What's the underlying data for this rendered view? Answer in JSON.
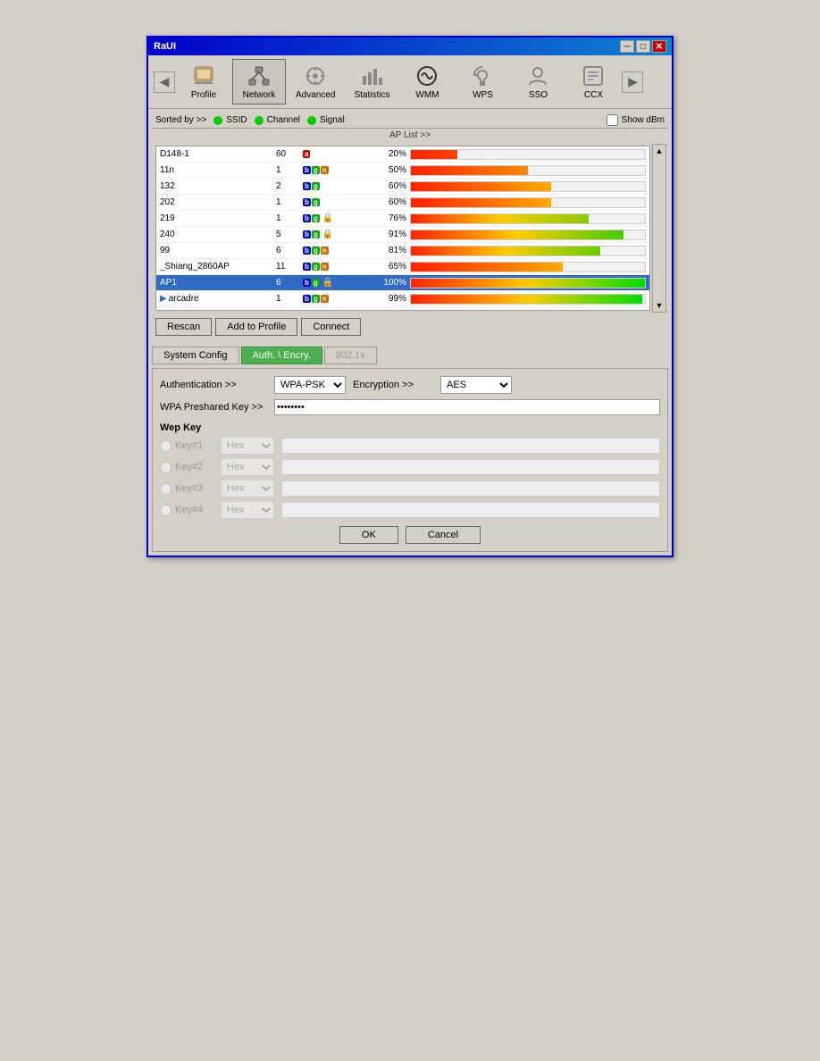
{
  "window": {
    "title": "RaUI",
    "close_btn": "✕",
    "min_btn": "─",
    "max_btn": "□"
  },
  "toolbar": {
    "back_label": "◀",
    "forward_label": "▶",
    "items": [
      {
        "id": "profile",
        "label": "Profile",
        "icon": "👤"
      },
      {
        "id": "network",
        "label": "Network",
        "icon": "📡"
      },
      {
        "id": "advanced",
        "label": "Advanced",
        "icon": "⚙"
      },
      {
        "id": "statistics",
        "label": "Statistics",
        "icon": "📊"
      },
      {
        "id": "wmm",
        "label": "WMM",
        "icon": "📶"
      },
      {
        "id": "wps",
        "label": "WPS",
        "icon": "🔒"
      },
      {
        "id": "sso",
        "label": "SSO",
        "icon": "🔑"
      },
      {
        "id": "ccx",
        "label": "CCX",
        "icon": "📋"
      }
    ]
  },
  "ap_list": {
    "sorted_by": "Sorted by >>",
    "col_ssid": "SSID",
    "col_channel": "Channel",
    "col_signal": "Signal",
    "show_dbm": "Show dBm",
    "list_title": "AP List >>",
    "entries": [
      {
        "name": "D148-1",
        "ch": "60",
        "badges": [
          "a"
        ],
        "pct": "20%",
        "signal": 20,
        "lock": false,
        "selected": false,
        "arrow": false
      },
      {
        "name": "11n",
        "ch": "1",
        "badges": [
          "b",
          "g",
          "n"
        ],
        "pct": "50%",
        "signal": 50,
        "lock": false,
        "selected": false,
        "arrow": false
      },
      {
        "name": "132",
        "ch": "2",
        "badges": [
          "b",
          "g"
        ],
        "pct": "60%",
        "signal": 60,
        "lock": false,
        "selected": false,
        "arrow": false
      },
      {
        "name": "202",
        "ch": "1",
        "badges": [
          "b",
          "g"
        ],
        "pct": "60%",
        "signal": 60,
        "lock": false,
        "selected": false,
        "arrow": false
      },
      {
        "name": "219",
        "ch": "1",
        "badges": [
          "b",
          "g"
        ],
        "pct": "76%",
        "signal": 76,
        "lock": true,
        "selected": false,
        "arrow": false
      },
      {
        "name": "240",
        "ch": "5",
        "badges": [
          "b",
          "g"
        ],
        "pct": "91%",
        "signal": 91,
        "lock": true,
        "selected": false,
        "arrow": false
      },
      {
        "name": "99",
        "ch": "6",
        "badges": [
          "b",
          "g",
          "n"
        ],
        "pct": "81%",
        "signal": 81,
        "lock": false,
        "selected": false,
        "arrow": false
      },
      {
        "name": "_Shiang_2860AP",
        "ch": "11",
        "badges": [
          "b",
          "g",
          "n"
        ],
        "pct": "65%",
        "signal": 65,
        "lock": false,
        "selected": false,
        "arrow": false
      },
      {
        "name": "AP1",
        "ch": "6",
        "badges": [
          "b",
          "g"
        ],
        "pct": "100%",
        "signal": 100,
        "lock": true,
        "selected": true,
        "arrow": false
      },
      {
        "name": "arcadre",
        "ch": "1",
        "badges": [
          "b",
          "g",
          "n"
        ],
        "pct": "99%",
        "signal": 99,
        "lock": false,
        "selected": false,
        "arrow": true
      }
    ],
    "rescan_btn": "Rescan",
    "add_profile_btn": "Add to Profile",
    "connect_btn": "Connect"
  },
  "config": {
    "tabs": [
      {
        "id": "system",
        "label": "System Config",
        "active": false
      },
      {
        "id": "auth",
        "label": "Auth. \\ Encry.",
        "active": true
      },
      {
        "id": "802_1x",
        "label": "802.1x",
        "active": false,
        "disabled": true
      }
    ],
    "auth_label": "Authentication >>",
    "auth_value": "WPA-PSK",
    "encr_label": "Encryption >>",
    "encr_value": "AES",
    "psk_label": "WPA Preshared Key >>",
    "psk_value": "••••••••",
    "wep_title": "Wep Key",
    "wep_keys": [
      {
        "id": "key1",
        "label": "Key#1",
        "format": "Hex",
        "active": false
      },
      {
        "id": "key2",
        "label": "Key#2",
        "format": "Hex",
        "active": false
      },
      {
        "id": "key3",
        "label": "Key#3",
        "format": "Hex",
        "active": false
      },
      {
        "id": "key4",
        "label": "Key#4",
        "format": "Hex",
        "active": false
      }
    ],
    "ok_btn": "OK",
    "cancel_btn": "Cancel"
  }
}
